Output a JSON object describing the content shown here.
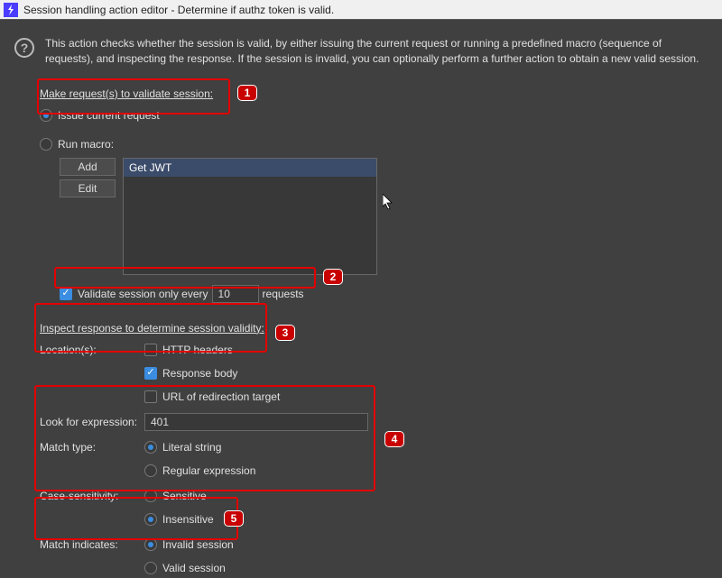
{
  "window": {
    "title": "Session handling action editor - Determine if authz token is valid."
  },
  "description": "This action checks whether the session is valid, by either issuing the current request or running a predefined macro (sequence of requests), and inspecting the response. If the session is invalid, you can optionally perform a further action to obtain a new valid session.",
  "sections": {
    "validate": {
      "heading": "Make request(s) to validate session:",
      "issue_current": "Issue current request",
      "run_macro": "Run macro:",
      "add_btn": "Add",
      "edit_btn": "Edit",
      "macro_item": "Get JWT",
      "validate_every": "Validate session only every",
      "validate_count": "10",
      "validate_unit": "requests"
    },
    "inspect": {
      "heading": "Inspect response to determine session validity:",
      "locations": "Location(s):",
      "http_headers": "HTTP headers",
      "response_body": "Response body",
      "url_redirect": "URL of redirection target",
      "look_for": "Look for expression:",
      "expr_value": "401",
      "match_type": "Match type:",
      "literal": "Literal string",
      "regex": "Regular expression",
      "case_sens": "Case-sensitivity:",
      "sensitive": "Sensitive",
      "insensitive": "Insensitive",
      "match_indicates": "Match indicates:",
      "invalid": "Invalid session",
      "valid": "Valid session"
    }
  },
  "callouts": {
    "c1": "1",
    "c2": "2",
    "c3": "3",
    "c4": "4",
    "c5": "5"
  }
}
